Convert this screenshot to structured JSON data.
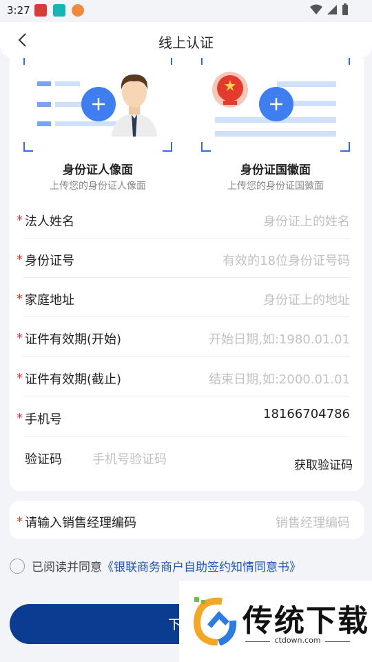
{
  "status_bar": {
    "time": "3:27"
  },
  "header": {
    "title": "线上认证"
  },
  "uploads": [
    {
      "title": "身份证人像面",
      "subtitle": "上传您的身份证人像面"
    },
    {
      "title": "身份证国徽面",
      "subtitle": "上传您的身份证国徽面"
    }
  ],
  "form": {
    "fields": [
      {
        "label": "法人姓名",
        "placeholder": "身份证上的姓名",
        "value": ""
      },
      {
        "label": "身份证号",
        "placeholder": "有效的18位身份证号码",
        "value": ""
      },
      {
        "label": "家庭地址",
        "placeholder": "身份证上的地址",
        "value": ""
      },
      {
        "label": "证件有效期(开始)",
        "placeholder": "开始日期,如:1980.01.01",
        "value": ""
      },
      {
        "label": "证件有效期(截止)",
        "placeholder": "结束日期,如:2000.01.01",
        "value": ""
      },
      {
        "label": "手机号",
        "placeholder": "",
        "value": "18166704786"
      }
    ],
    "verify": {
      "label": "验证码",
      "placeholder": "手机号验证码",
      "button": "获取验证码"
    },
    "manager": {
      "label": "请输入销售经理编码",
      "placeholder": "销售经理编码"
    }
  },
  "agreement": {
    "prefix": "已阅读并同意",
    "link": "《银联商务商户自助签约知情同意书》"
  },
  "next_button": {
    "label": "下"
  },
  "watermark": {
    "title": "传统下载",
    "url": "ctdown.com"
  },
  "colors": {
    "accent": "#3f7ef0",
    "primary_button": "#0a3d91",
    "required": "#e33333",
    "link": "#1d55b8"
  }
}
